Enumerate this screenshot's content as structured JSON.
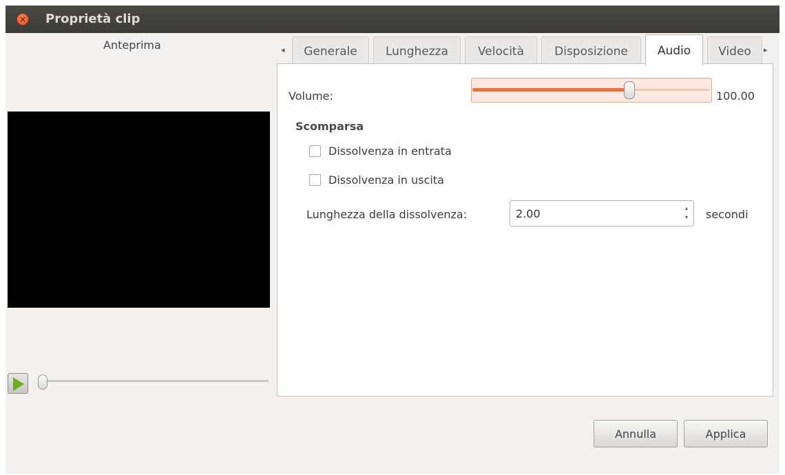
{
  "window": {
    "title": "Proprietà clip",
    "close_glyph": "×"
  },
  "preview": {
    "label": "Anteprima",
    "play_icon": "play-icon"
  },
  "tabs": [
    {
      "label": "Generale",
      "active": false
    },
    {
      "label": "Lunghezza",
      "active": false
    },
    {
      "label": "Velocità",
      "active": false
    },
    {
      "label": "Disposizione",
      "active": false
    },
    {
      "label": "Audio",
      "active": true
    },
    {
      "label": "Video",
      "active": false
    }
  ],
  "tab_scroll": {
    "left": "◂",
    "right": "▸"
  },
  "audio": {
    "volume_label": "Volume:",
    "volume_value": "100.00",
    "volume_fraction": 0.67,
    "section_title": "Scomparsa",
    "fade_in_label": "Dissolvenza in entrata",
    "fade_in_checked": false,
    "fade_out_label": "Dissolvenza in uscita",
    "fade_out_checked": false,
    "fade_length_label": "Lunghezza della dissolvenza:",
    "fade_length_value": "2.00",
    "fade_length_unit": "secondi",
    "spin_up": "▴",
    "spin_down": "▾"
  },
  "buttons": {
    "cancel": "Annulla",
    "apply": "Applica"
  },
  "colors": {
    "accent": "#e9713f",
    "titlebar": "#3c3b37",
    "play": "#6ab01e"
  }
}
